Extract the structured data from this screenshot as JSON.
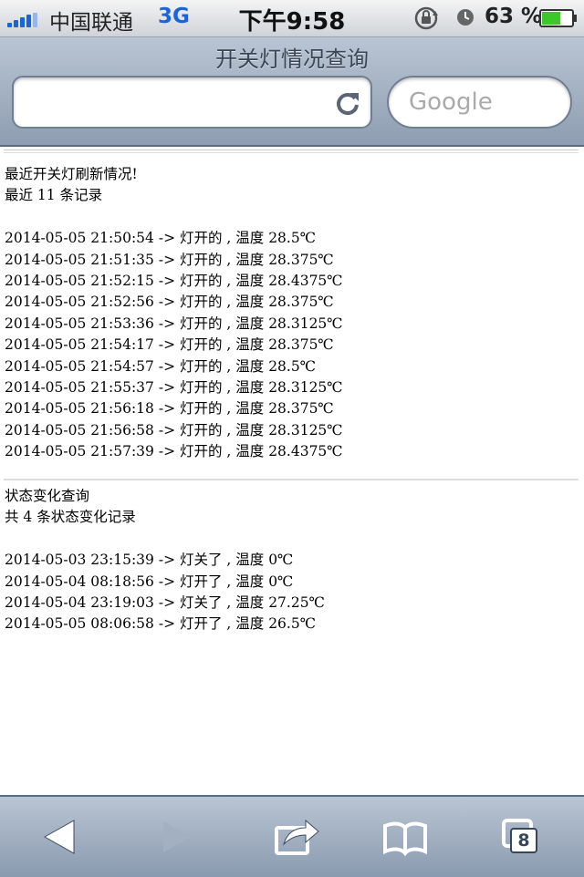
{
  "status_bar": {
    "carrier": "中国联通",
    "network": "3G",
    "time": "下午9:58",
    "battery_percent": "63 %",
    "battery_level": 0.63
  },
  "navbar": {
    "title": "开关灯情况查询",
    "url_value": "",
    "search_placeholder": "Google"
  },
  "recent": {
    "heading": "最近开关灯刷新情况!",
    "count_text": "最近 11 条记录",
    "records": [
      "2014-05-05 21:50:54 -> 灯开的 , 温度 28.5℃",
      "2014-05-05 21:51:35 -> 灯开的 , 温度 28.375℃",
      "2014-05-05 21:52:15 -> 灯开的 , 温度 28.4375℃",
      "2014-05-05 21:52:56 -> 灯开的 , 温度 28.375℃",
      "2014-05-05 21:53:36 -> 灯开的 , 温度 28.3125℃",
      "2014-05-05 21:54:17 -> 灯开的 , 温度 28.375℃",
      "2014-05-05 21:54:57 -> 灯开的 , 温度 28.5℃",
      "2014-05-05 21:55:37 -> 灯开的 , 温度 28.3125℃",
      "2014-05-05 21:56:18 -> 灯开的 , 温度 28.375℃",
      "2014-05-05 21:56:58 -> 灯开的 , 温度 28.3125℃",
      "2014-05-05 21:57:39 -> 灯开的 , 温度 28.4375℃"
    ]
  },
  "changes": {
    "heading": "状态变化查询",
    "count_text": "共 4 条状态变化记录",
    "records": [
      "2014-05-03 23:15:39 -> 灯关了 , 温度 0℃",
      "2014-05-04 08:18:56 -> 灯开了 , 温度 0℃",
      "2014-05-04 23:19:03 -> 灯关了 , 温度 27.25℃",
      "2014-05-05 08:06:58 -> 灯开了 , 温度 26.5℃"
    ]
  },
  "toolbar": {
    "pages_count": "8",
    "icons": [
      "back-icon",
      "forward-icon",
      "share-icon",
      "bookmarks-icon",
      "pages-icon"
    ]
  },
  "colors": {
    "accent_blue": "#1c63d6",
    "battery_green": "#3ec72b",
    "bar_gradient_top": "#b9c5d3",
    "bar_gradient_bottom": "#8e9db1"
  }
}
